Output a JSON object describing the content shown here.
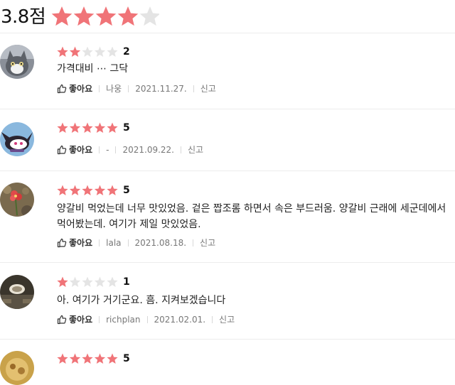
{
  "summary": {
    "score": "3.8점",
    "rating": 4
  },
  "colors": {
    "star_on": "#f07478",
    "star_off": "#e4e4e4"
  },
  "labels": {
    "like": "좋아요",
    "report": "신고"
  },
  "reviews": [
    {
      "rating": 2,
      "rating_text": "2",
      "text": "가격대비 ⋯ 그닥",
      "author": "나웅",
      "date": "2021.11.27.",
      "avatar_icon": "cat-avatar-icon"
    },
    {
      "rating": 5,
      "rating_text": "5",
      "text": "",
      "author": "-",
      "date": "2021.09.22.",
      "avatar_icon": "cartoon-avatar-icon"
    },
    {
      "rating": 5,
      "rating_text": "5",
      "text": "양갈비 먹었는데 너무 맛있었음. 겉은 짭조롬 하면서 속은 부드러움. 양갈비 근래에 세군데에서 먹어봤는데. 여기가 제일 맛있었음.",
      "author": "lala",
      "date": "2021.08.18.",
      "avatar_icon": "flower-avatar-icon"
    },
    {
      "rating": 1,
      "rating_text": "1",
      "text": "아. 여기가 거기군요.  흠.   지켜보겠습니다",
      "author": "richplan",
      "date": "2021.02.01.",
      "avatar_icon": "room-avatar-icon"
    },
    {
      "rating": 5,
      "rating_text": "5",
      "text": "",
      "author": "",
      "date": "",
      "avatar_icon": "food-avatar-icon"
    }
  ]
}
